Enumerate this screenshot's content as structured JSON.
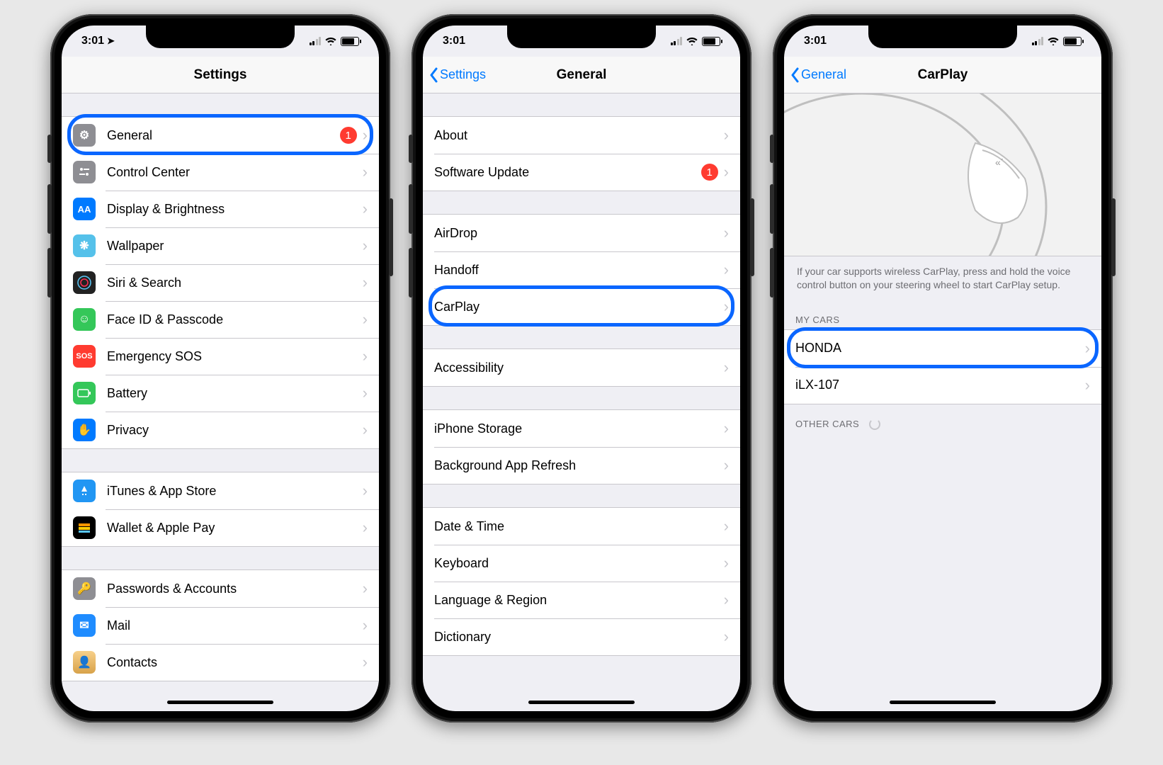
{
  "status": {
    "time": "3:01",
    "location_icon": "location-arrow"
  },
  "phone1": {
    "nav": {
      "title": "Settings"
    },
    "rows": [
      {
        "icon": "gear",
        "label": "General",
        "badge": "1",
        "highlight": true,
        "color": "ic-general"
      },
      {
        "icon": "sliders",
        "label": "Control Center",
        "color": "ic-cc"
      },
      {
        "icon": "AA",
        "label": "Display & Brightness",
        "color": "ic-disp"
      },
      {
        "icon": "flower",
        "label": "Wallpaper",
        "color": "ic-wall"
      },
      {
        "icon": "siri",
        "label": "Siri & Search",
        "color": "ic-siri"
      },
      {
        "icon": "face",
        "label": "Face ID & Passcode",
        "color": "ic-face"
      },
      {
        "icon": "SOS",
        "label": "Emergency SOS",
        "color": "ic-sos"
      },
      {
        "icon": "battery",
        "label": "Battery",
        "color": "ic-bat"
      },
      {
        "icon": "hand",
        "label": "Privacy",
        "color": "ic-priv"
      }
    ],
    "group2": [
      {
        "icon": "A",
        "label": "iTunes & App Store",
        "color": "ic-itunes"
      },
      {
        "icon": "wallet",
        "label": "Wallet & Apple Pay",
        "color": "ic-wallet"
      }
    ],
    "group3": [
      {
        "icon": "key",
        "label": "Passwords & Accounts",
        "color": "ic-pass"
      },
      {
        "icon": "mail",
        "label": "Mail",
        "color": "ic-mail"
      },
      {
        "icon": "person",
        "label": "Contacts",
        "color": "ic-contacts"
      }
    ]
  },
  "phone2": {
    "nav": {
      "back": "Settings",
      "title": "General"
    },
    "group1": [
      {
        "label": "About"
      },
      {
        "label": "Software Update",
        "badge": "1"
      }
    ],
    "group2": [
      {
        "label": "AirDrop"
      },
      {
        "label": "Handoff"
      },
      {
        "label": "CarPlay",
        "highlight": true
      }
    ],
    "group3": [
      {
        "label": "Accessibility"
      }
    ],
    "group4": [
      {
        "label": "iPhone Storage"
      },
      {
        "label": "Background App Refresh"
      }
    ],
    "group5": [
      {
        "label": "Date & Time"
      },
      {
        "label": "Keyboard"
      },
      {
        "label": "Language & Region"
      },
      {
        "label": "Dictionary"
      }
    ]
  },
  "phone3": {
    "nav": {
      "back": "General",
      "title": "CarPlay"
    },
    "help": "If your car supports wireless CarPlay, press and hold the voice control button on your steering wheel to start CarPlay setup.",
    "header1": "MY CARS",
    "cars": [
      {
        "label": "HONDA",
        "highlight": true
      },
      {
        "label": "iLX-107"
      }
    ],
    "header2": "OTHER CARS"
  }
}
